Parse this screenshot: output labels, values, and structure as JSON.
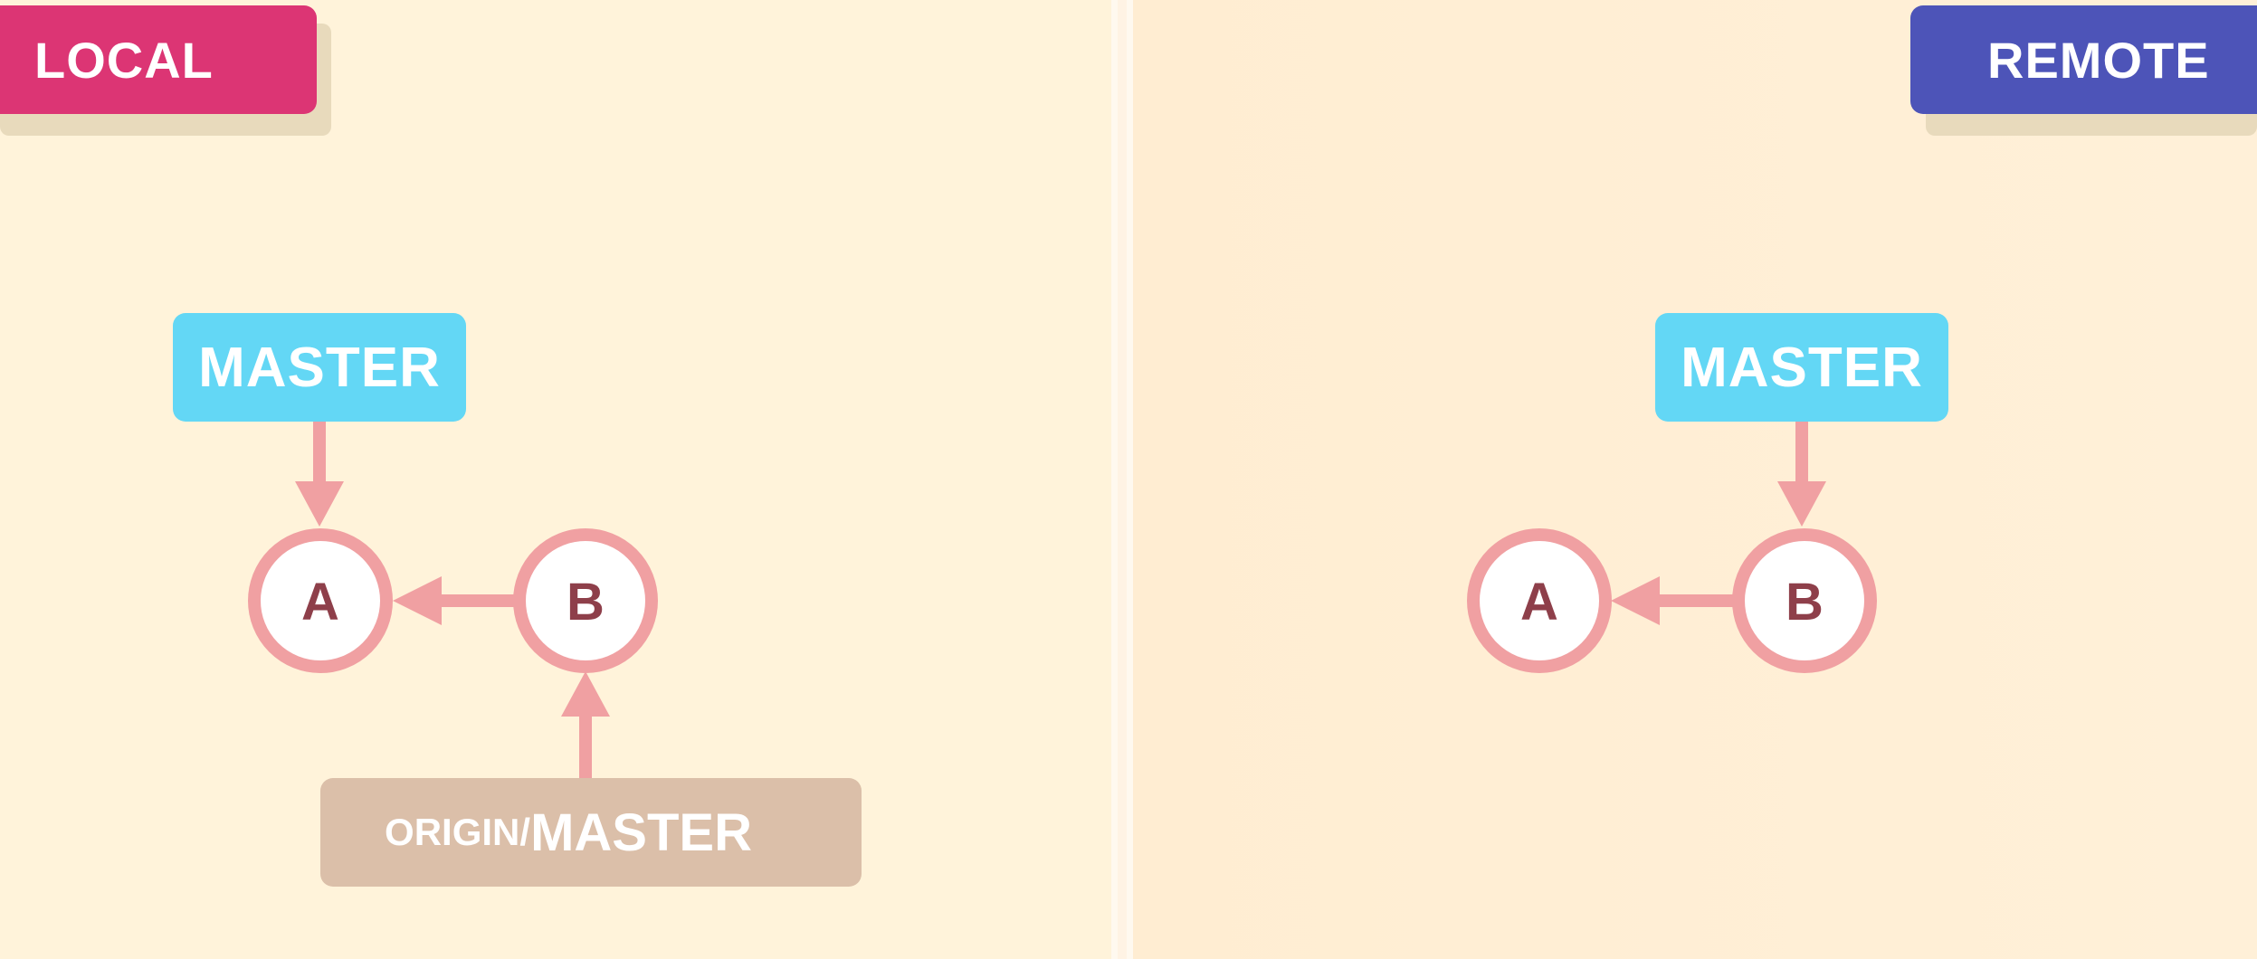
{
  "local": {
    "tag": "LOCAL",
    "master_label": "MASTER",
    "origin_master": {
      "prefix": "ORIGIN/",
      "branch": "MASTER"
    },
    "commits": [
      "A",
      "B"
    ]
  },
  "remote": {
    "tag": "REMOTE",
    "master_label": "MASTER",
    "commits": [
      "A",
      "B"
    ]
  },
  "colors": {
    "local_tag": "#dc3574",
    "remote_tag": "#4d54b8",
    "branch_label": "#63d7f5",
    "origin_label": "#dbbfa9",
    "arrow": "#f0a0a2",
    "commit_ring": "#f0a0a2",
    "commit_text": "#8e3f4a"
  }
}
